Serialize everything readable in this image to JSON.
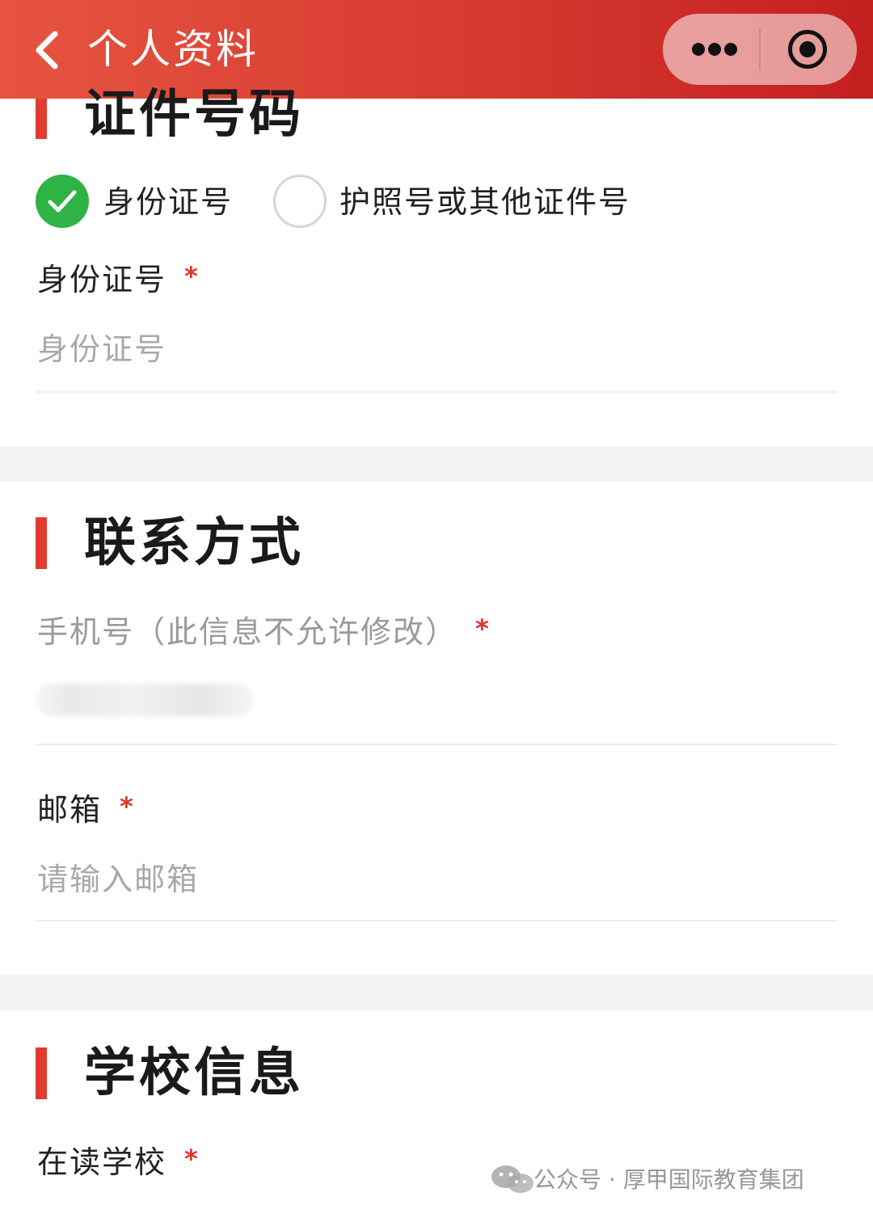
{
  "header": {
    "title": "个人资料",
    "back_icon": "chevron-left-icon",
    "more_icon": "more-dots-icon",
    "close_icon": "target-close-icon",
    "gradient": [
      "#e65440",
      "#c41f1f"
    ]
  },
  "id_section": {
    "title": "证件号码",
    "options": [
      {
        "label": "身份证号",
        "checked": true
      },
      {
        "label": "护照号或其他证件号",
        "checked": false
      }
    ],
    "field": {
      "label": "身份证号",
      "required_mark": "*",
      "placeholder": "身份证号",
      "value": ""
    }
  },
  "contact_section": {
    "title": "联系方式",
    "phone": {
      "label": "手机号（此信息不允许修改）",
      "required_mark": "*"
    },
    "email": {
      "label": "邮箱",
      "required_mark": "*",
      "placeholder": "请输入邮箱",
      "value": ""
    }
  },
  "school_section": {
    "title": "学校信息",
    "school": {
      "label": "在读学校",
      "required_mark": "*"
    }
  },
  "watermark": {
    "text": "公众号 · 厚甲国际教育集团",
    "icon": "wechat-icon"
  },
  "colors": {
    "accent": "#e03c31",
    "check": "#2fb344",
    "required": "#e0342a"
  }
}
